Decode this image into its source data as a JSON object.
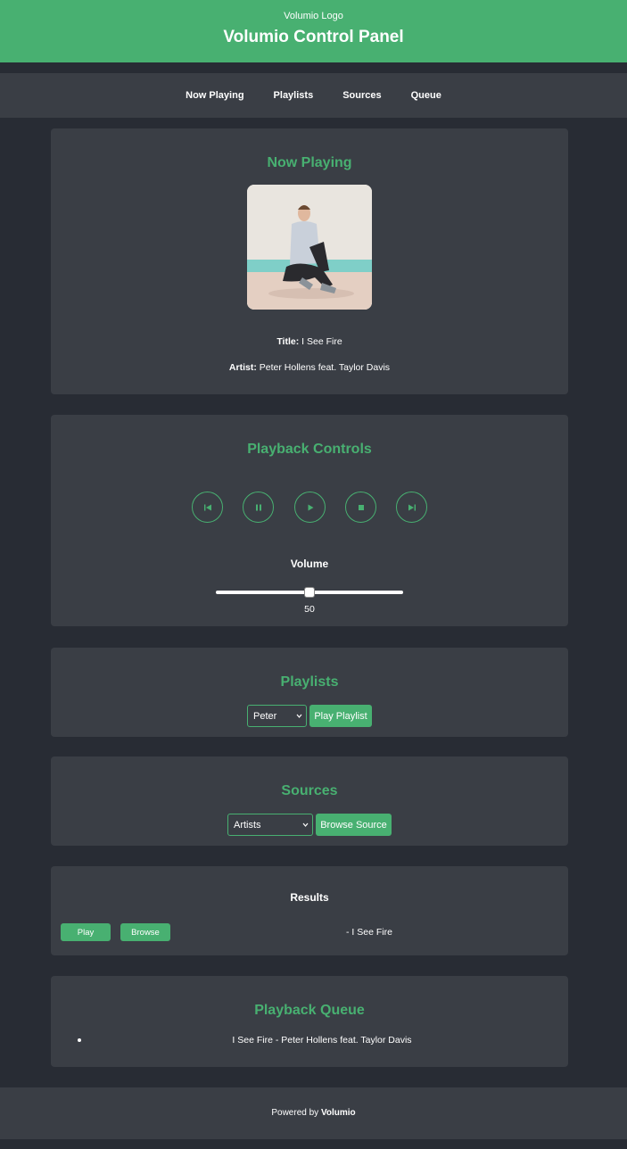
{
  "header": {
    "logo_text": "Volumio Logo",
    "title": "Volumio Control Panel"
  },
  "nav": {
    "items": [
      "Now Playing",
      "Playlists",
      "Sources",
      "Queue"
    ]
  },
  "now_playing": {
    "heading": "Now Playing",
    "title_label": "Title:",
    "title_value": "I See Fire",
    "artist_label": "Artist:",
    "artist_value": "Peter Hollens feat. Taylor Davis"
  },
  "controls": {
    "heading": "Playback Controls",
    "buttons": [
      "previous-icon",
      "pause-icon",
      "play-icon",
      "stop-icon",
      "next-icon"
    ],
    "volume_label": "Volume",
    "volume_value": "50",
    "volume_fraction": 0.5
  },
  "playlists": {
    "heading": "Playlists",
    "selected": "Peter",
    "play_label": "Play Playlist"
  },
  "sources": {
    "heading": "Sources",
    "selected": "Artists",
    "browse_label": "Browse Source"
  },
  "results": {
    "heading": "Results",
    "play_label": "Play",
    "browse_label": "Browse",
    "item_text": "- I See Fire"
  },
  "queue": {
    "heading": "Playback Queue",
    "items": [
      "I See Fire - Peter Hollens feat. Taylor Davis"
    ]
  },
  "footer": {
    "prefix": "Powered by",
    "brand": "Volumio"
  },
  "colors": {
    "accent": "#48b071",
    "background": "#282c34",
    "card": "#3a3e45"
  }
}
